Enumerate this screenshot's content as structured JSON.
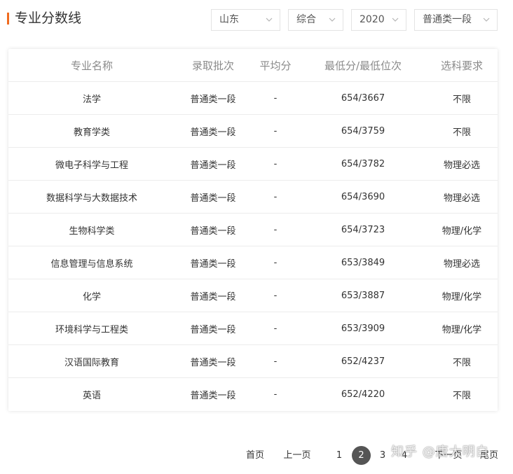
{
  "header": {
    "title": "专业分数线",
    "accent_color": "#f06b1f"
  },
  "filters": {
    "province": "山东",
    "subject": "综合",
    "year": "2020",
    "batch": "普通类一段"
  },
  "table": {
    "columns": [
      "专业名称",
      "录取批次",
      "平均分",
      "最低分/最低位次",
      "选科要求"
    ],
    "rows": [
      {
        "major": "法学",
        "batch": "普通类一段",
        "avg": "-",
        "min": "654/3667",
        "req": "不限"
      },
      {
        "major": "教育学类",
        "batch": "普通类一段",
        "avg": "-",
        "min": "654/3759",
        "req": "不限"
      },
      {
        "major": "微电子科学与工程",
        "batch": "普通类一段",
        "avg": "-",
        "min": "654/3782",
        "req": "物理必选"
      },
      {
        "major": "数据科学与大数据技术",
        "batch": "普通类一段",
        "avg": "-",
        "min": "654/3690",
        "req": "物理必选"
      },
      {
        "major": "生物科学类",
        "batch": "普通类一段",
        "avg": "-",
        "min": "654/3723",
        "req": "物理/化学"
      },
      {
        "major": "信息管理与信息系统",
        "batch": "普通类一段",
        "avg": "-",
        "min": "653/3849",
        "req": "物理必选"
      },
      {
        "major": "化学",
        "batch": "普通类一段",
        "avg": "-",
        "min": "653/3887",
        "req": "物理/化学"
      },
      {
        "major": "环境科学与工程类",
        "batch": "普通类一段",
        "avg": "-",
        "min": "653/3909",
        "req": "物理/化学"
      },
      {
        "major": "汉语国际教育",
        "batch": "普通类一段",
        "avg": "-",
        "min": "652/4237",
        "req": "不限"
      },
      {
        "major": "英语",
        "batch": "普通类一段",
        "avg": "-",
        "min": "652/4220",
        "req": "不限"
      }
    ]
  },
  "pagination": {
    "first": "首页",
    "prev": "上一页",
    "pages": [
      "1",
      "2",
      "3",
      "4"
    ],
    "current": "2",
    "next": "下一页",
    "last": "尾页"
  },
  "watermark": "知乎 @唐大明白"
}
